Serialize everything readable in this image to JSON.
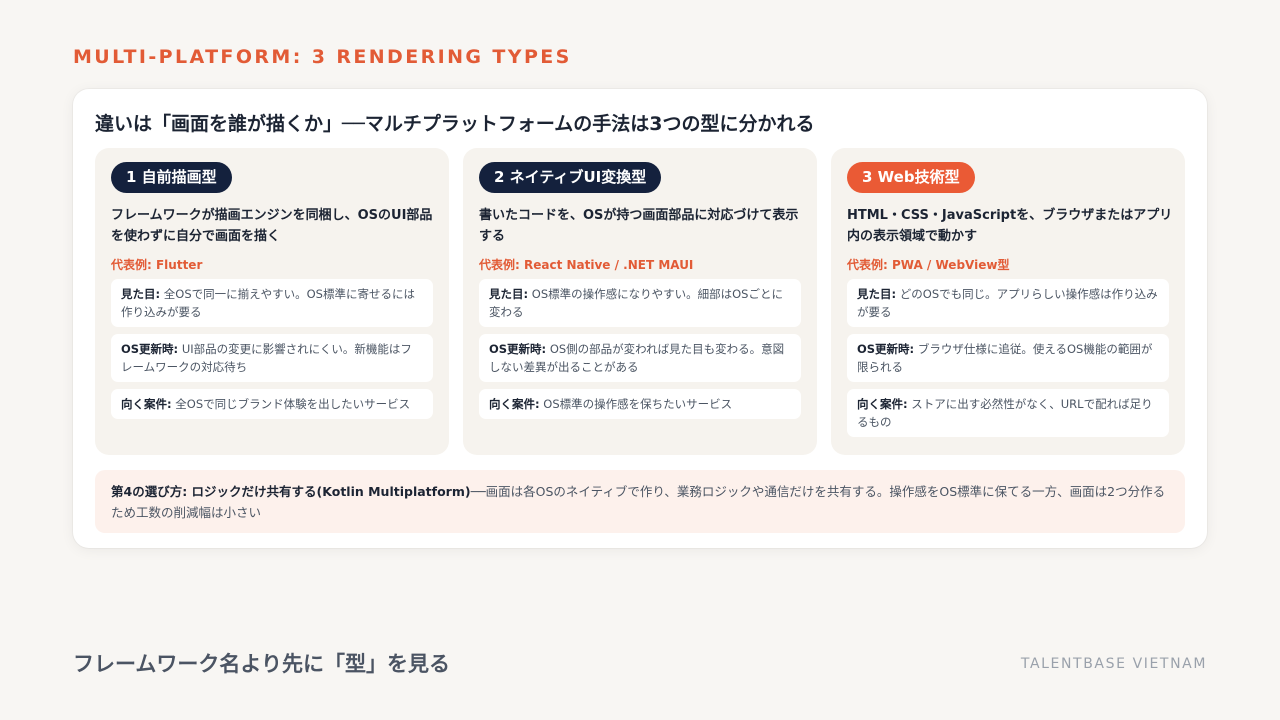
{
  "eyebrow": "MULTI-PLATFORM: 3 RENDERING TYPES",
  "card": {
    "title": "違いは「画面を誰が描くか」──マルチプラットフォームの手法は3つの型に分かれる"
  },
  "columns": [
    {
      "badge": "1 自前描画型",
      "badge_color": "#14213d",
      "description": "フレームワークが描画エンジンを同梱し、OSのUI部品を使わずに自分で画面を描く",
      "example": "代表例: Flutter",
      "items": [
        {
          "label": "見た目:",
          "text": "全OSで同一に揃えやすい。OS標準に寄せるには作り込みが要る"
        },
        {
          "label": "OS更新時:",
          "text": "UI部品の変更に影響されにくい。新機能はフレームワークの対応待ち"
        },
        {
          "label": "向く案件:",
          "text": "全OSで同じブランド体験を出したいサービス"
        }
      ]
    },
    {
      "badge": "2 ネイティブUI変換型",
      "badge_color": "#14213d",
      "description": "書いたコードを、OSが持つ画面部品に対応づけて表示する",
      "example": "代表例: React Native / .NET MAUI",
      "items": [
        {
          "label": "見た目:",
          "text": "OS標準の操作感になりやすい。細部はOSごとに変わる"
        },
        {
          "label": "OS更新時:",
          "text": "OS側の部品が変われば見た目も変わる。意図しない差異が出ることがある"
        },
        {
          "label": "向く案件:",
          "text": "OS標準の操作感を保ちたいサービス"
        }
      ]
    },
    {
      "badge": "3 Web技術型",
      "badge_color": "#ea5a35",
      "description": "HTML・CSS・JavaScriptを、ブラウザまたはアプリ内の表示領域で動かす",
      "example": "代表例: PWA / WebView型",
      "items": [
        {
          "label": "見た目:",
          "text": "どのOSでも同じ。アプリらしい操作感は作り込みが要る"
        },
        {
          "label": "OS更新時:",
          "text": "ブラウザ仕様に追従。使えるOS機能の範囲が限られる"
        },
        {
          "label": "向く案件:",
          "text": "ストアに出す必然性がなく、URLで配れば足りるもの"
        }
      ]
    }
  ],
  "note": {
    "label": "第4の選び方: ロジックだけ共有する(Kotlin Multiplatform)",
    "text": "──画面は各OSのネイティブで作り、業務ロジックや通信だけを共有する。操作感をOS標準に保てる一方、画面は2つ分作るため工数の削減幅は小さい"
  },
  "footer": {
    "title": "フレームワーク名より先に「型」を見る",
    "brand": "TALENTBASE VIETNAM"
  }
}
